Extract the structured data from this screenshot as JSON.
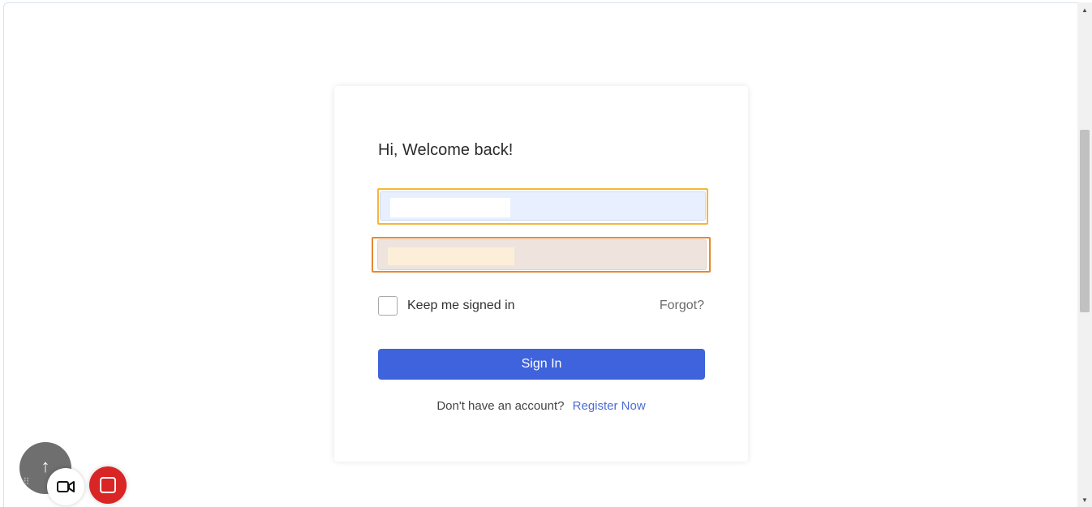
{
  "login": {
    "title": "Hi, Welcome back!",
    "remember_label": "Keep me signed in",
    "forgot_label": "Forgot?",
    "signin_label": "Sign In",
    "register_prefix": "Don't have an account?",
    "register_link": "Register Now"
  },
  "colors": {
    "primary": "#3f63dc",
    "link": "#4d6bd6",
    "highlight_yellow": "#f4b63f",
    "highlight_orange": "#e7892f",
    "record": "#d92525"
  },
  "icons": {
    "scroll_up": "▲",
    "scroll_down": "▼",
    "recorder_grab": "⠿",
    "recorder_collapse": "↑"
  }
}
